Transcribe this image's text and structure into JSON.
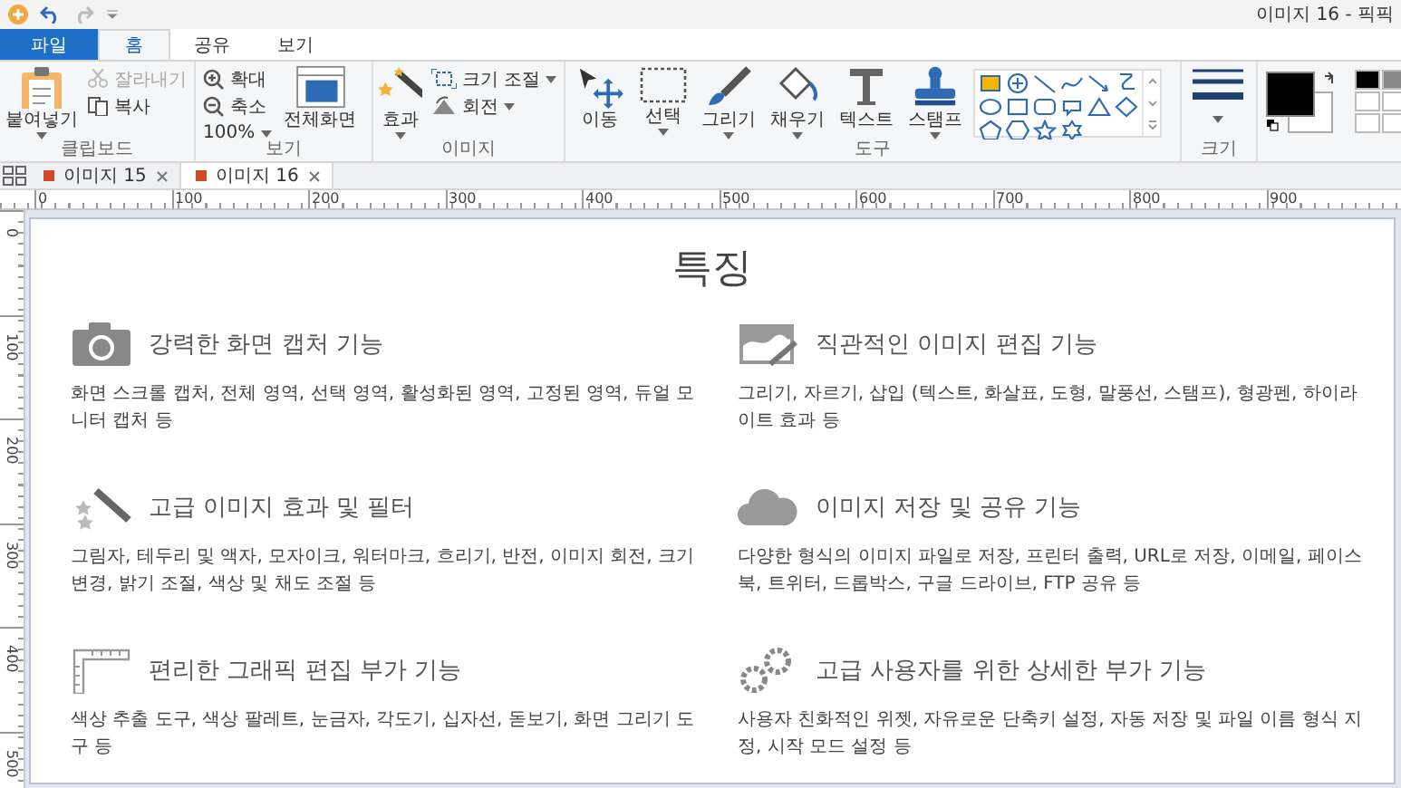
{
  "window": {
    "title": "이미지 16 - 픽픽"
  },
  "ribbon_tabs": [
    {
      "label": "파일",
      "kind": "file",
      "selected": false
    },
    {
      "label": "홈",
      "kind": "tab",
      "selected": true
    },
    {
      "label": "공유",
      "kind": "tab",
      "selected": false
    },
    {
      "label": "보기",
      "kind": "tab",
      "selected": false
    }
  ],
  "ribbon": {
    "groups": [
      {
        "label": "클립보드",
        "items": [
          {
            "kind": "large",
            "label": "붙여넣기",
            "dropdown": true
          },
          {
            "kind": "stack",
            "items": [
              {
                "label": "잘라내기",
                "disabled": true,
                "dropdown": false
              },
              {
                "label": "복사",
                "disabled": false,
                "dropdown": false
              }
            ]
          }
        ]
      },
      {
        "label": "보기",
        "items": [
          {
            "kind": "stack",
            "items": [
              {
                "label": "확대",
                "disabled": false,
                "dropdown": false
              },
              {
                "label": "축소",
                "disabled": false,
                "dropdown": false
              },
              {
                "label": "100%",
                "disabled": false,
                "dropdown": true
              }
            ]
          },
          {
            "kind": "large",
            "label": "전체화면",
            "dropdown": false
          }
        ]
      },
      {
        "label": "이미지",
        "items": [
          {
            "kind": "large",
            "label": "효과",
            "dropdown": true
          },
          {
            "kind": "stack",
            "items": [
              {
                "label": "크기 조절",
                "disabled": false,
                "dropdown": true
              },
              {
                "label": "회전",
                "disabled": false,
                "dropdown": true
              }
            ]
          }
        ]
      },
      {
        "label": "도구",
        "items": [
          {
            "kind": "large",
            "label": "이동",
            "dropdown": false
          },
          {
            "kind": "large",
            "label": "선택",
            "dropdown": true
          },
          {
            "kind": "large",
            "label": "그리기",
            "dropdown": true
          },
          {
            "kind": "large",
            "label": "채우기",
            "dropdown": true
          },
          {
            "kind": "large",
            "label": "텍스트",
            "dropdown": false
          },
          {
            "kind": "large",
            "label": "스탬프",
            "dropdown": true
          },
          {
            "kind": "gallery"
          }
        ]
      },
      {
        "label": "크기",
        "items": [
          {
            "kind": "size",
            "dropdown": true
          }
        ]
      },
      {
        "items": [
          {
            "kind": "colors"
          }
        ]
      }
    ]
  },
  "document_tabs": [
    {
      "label": "이미지 15",
      "selected": false
    },
    {
      "label": "이미지 16",
      "selected": true
    }
  ],
  "horizontal_ruler": [
    "0",
    "100",
    "200",
    "300",
    "400",
    "500",
    "600",
    "700",
    "800",
    "900"
  ],
  "vertical_ruler": [
    "0",
    "100",
    "200",
    "300",
    "400",
    "500"
  ],
  "page": {
    "title": "특징",
    "features": [
      {
        "title": "강력한 화면 캡처 기능",
        "description": "화면 스크롤 캡처, 전체 영역, 선택 영역, 활성화된 영역, 고정된 영역, 듀얼 모니터 캡처 등"
      },
      {
        "title": "직관적인 이미지 편집 기능",
        "description": "그리기, 자르기, 삽입 (텍스트, 화살표, 도형, 말풍선, 스탬프), 형광펜, 하이라이트 효과 등"
      },
      {
        "title": "고급 이미지 효과 및 필터",
        "description": "그림자, 테두리 및 액자, 모자이크, 워터마크, 흐리기, 반전, 이미지 회전, 크기 변경, 밝기 조절, 색상 및 채도 조절 등"
      },
      {
        "title": "이미지 저장 및 공유 기능",
        "description": "다양한 형식의 이미지 파일로 저장, 프린터 출력, URL로 저장, 이메일, 페이스북, 트위터, 드롭박스, 구글 드라이브, FTP 공유 등"
      },
      {
        "title": "편리한 그래픽 편집 부가 기능",
        "description": "색상 추출 도구, 색상 팔레트, 눈금자, 각도기, 십자선, 돋보기, 화면 그리기 도구 등"
      },
      {
        "title": "고급 사용자를 위한 상세한 부가 기능",
        "description": "사용자 친화적인 위젯, 자유로운 단축키 설정, 자동 저장 및 파일 이름 형식 지정, 시작 모드 설정 등"
      }
    ]
  }
}
